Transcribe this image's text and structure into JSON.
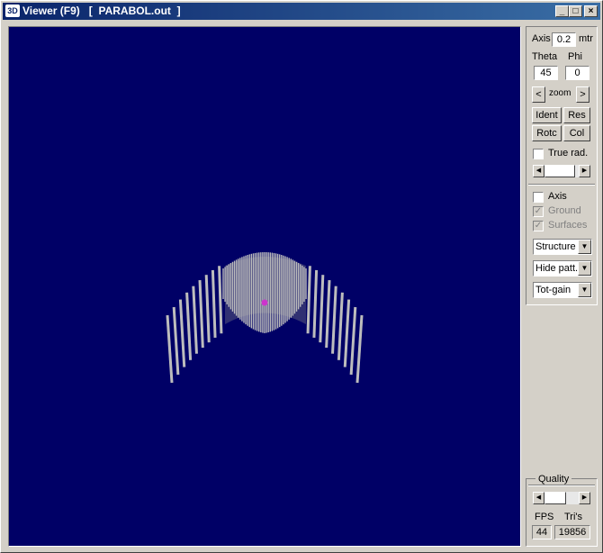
{
  "window": {
    "icon": "3D",
    "title": "Viewer (F9)   [  PARABOL.out  ]",
    "controls": {
      "minimize": "_",
      "maximize": "□",
      "close": "×"
    }
  },
  "panel": {
    "axis_label": "Axis",
    "axis_value": "0.2",
    "axis_unit": "mtr",
    "theta_label": "Theta",
    "phi_label": "Phi",
    "theta_value": "45",
    "phi_value": "0",
    "zoom_label": "zoom",
    "zoom_left": "<",
    "zoom_right": ">",
    "ident": "Ident",
    "res": "Res",
    "rotc": "Rotc",
    "col": "Col",
    "true_rad_label": "True rad.",
    "axis_check_label": "Axis",
    "ground_label": "Ground",
    "surfaces_label": "Surfaces",
    "ground_checked": true,
    "surfaces_checked": true,
    "structure_select": "Structure",
    "hide_select": "Hide patt.",
    "gain_select": "Tot-gain"
  },
  "quality": {
    "label": "Quality",
    "fps_label": "FPS",
    "tris_label": "Tri's",
    "fps_value": "44",
    "tris_value": "19856"
  },
  "colors": {
    "viewport_bg": "#000066",
    "wire": "#bdbdbd",
    "feed_marker": "#cc33cc",
    "titlebar_start": "#0a246a",
    "titlebar_end": "#3a6ea5"
  },
  "icons": [
    "minimize-icon",
    "maximize-icon",
    "close-icon",
    "chevron-left-icon",
    "chevron-right-icon",
    "chevron-down-icon",
    "check-icon"
  ]
}
